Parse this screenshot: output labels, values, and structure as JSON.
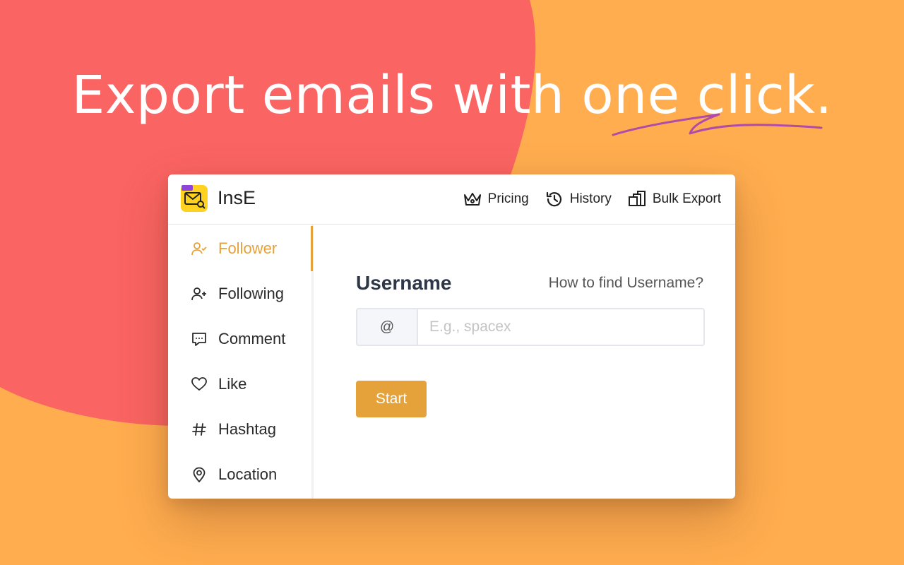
{
  "hero": {
    "headline": "Export emails with one click."
  },
  "app": {
    "name": "InsE",
    "logo_icon": "mail-search-icon",
    "nav": [
      {
        "label": "Pricing",
        "icon": "crown-icon"
      },
      {
        "label": "History",
        "icon": "history-icon"
      },
      {
        "label": "Bulk Export",
        "icon": "bulk-export-icon"
      }
    ]
  },
  "sidebar": {
    "active_index": 0,
    "items": [
      {
        "label": "Follower",
        "icon": "follower-icon"
      },
      {
        "label": "Following",
        "icon": "add-user-icon"
      },
      {
        "label": "Comment",
        "icon": "comment-icon"
      },
      {
        "label": "Like",
        "icon": "heart-icon"
      },
      {
        "label": "Hashtag",
        "icon": "hashtag-icon"
      },
      {
        "label": "Location",
        "icon": "location-pin-icon"
      }
    ]
  },
  "form": {
    "label": "Username",
    "help_link": "How to find Username?",
    "prefix": "@",
    "input_value": "",
    "placeholder": "E.g., spacex",
    "submit_label": "Start"
  },
  "colors": {
    "background": "#FFAD4F",
    "blob": "#FA6462",
    "accent": "#E5A23A",
    "scribble": "#B04CA8"
  }
}
